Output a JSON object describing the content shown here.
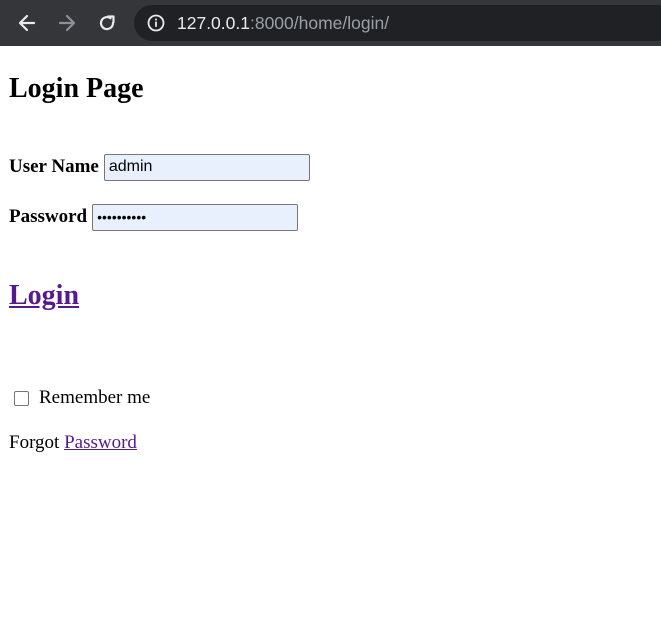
{
  "browser": {
    "url_host": "127.0.0.1",
    "url_path": ":8000/home/login/",
    "icons": {
      "back": "arrow-left-icon",
      "forward": "arrow-right-icon",
      "reload": "reload-icon",
      "info": "info-icon"
    },
    "colors": {
      "toolbar": "#35363a",
      "omnibox": "#202124"
    }
  },
  "page": {
    "title": "Login Page",
    "username_label": "User Name",
    "username_value": "admin",
    "password_label": "Password",
    "password_value": "••••••••••",
    "login_link": "Login",
    "remember_label": "Remember me",
    "remember_checked": false,
    "forgot_text": "Forgot",
    "forgot_link": "Password",
    "colors": {
      "visited_link": "#551a8b",
      "autofill_bg": "#e8f0fe"
    }
  }
}
